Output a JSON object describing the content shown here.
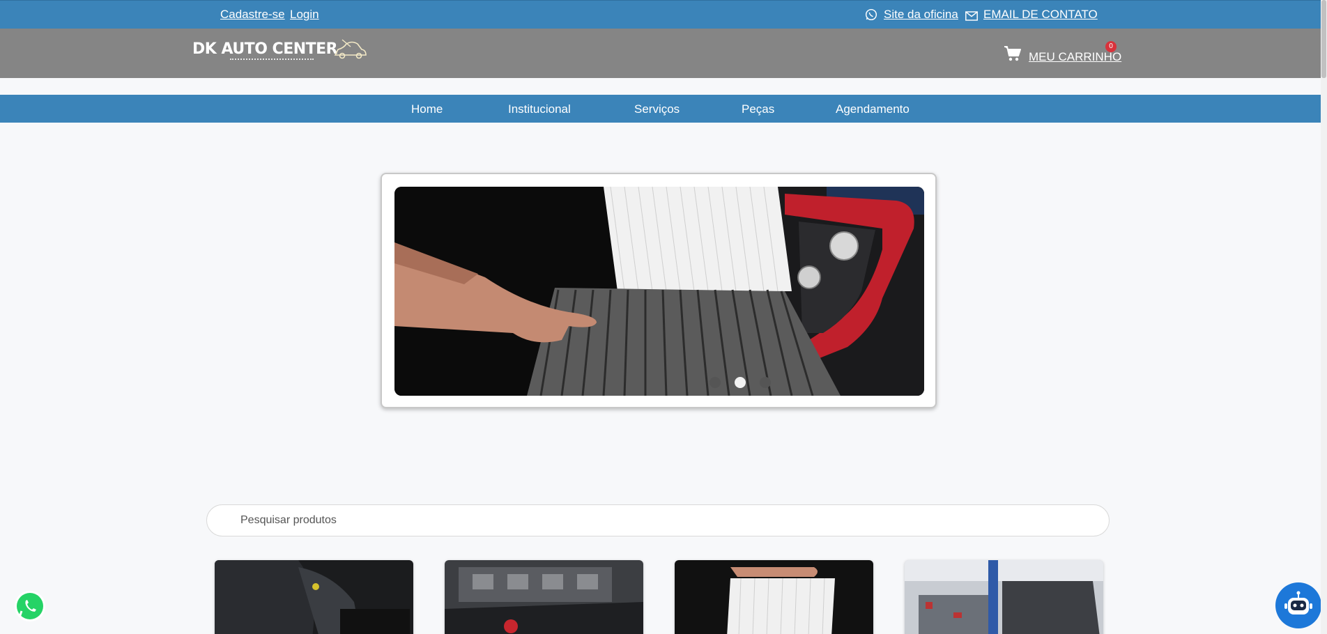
{
  "topbar": {
    "signup": "Cadastre-se",
    "login": "Login",
    "workshop_site": "Site da oficina",
    "contact_email": "EMAIL DE CONTATO",
    "workshop_icon": "whatsapp-icon",
    "email_icon": "mail-icon"
  },
  "header": {
    "logo_text": "DK AUTO CENTER",
    "cart_label": "MEU CARRINHO",
    "cart_count": "0"
  },
  "nav": {
    "items": [
      "Home",
      "Institucional",
      "Serviços",
      "Peças",
      "Agendamento"
    ]
  },
  "carousel": {
    "slides": 3,
    "active_slide": 2
  },
  "search": {
    "placeholder": "Pesquisar produtos"
  },
  "colors": {
    "primary": "#3b84b9",
    "header_gray": "#858585",
    "badge_red": "#d9323b",
    "chatbot_blue": "#1d78d9",
    "whatsapp_green": "#25d366"
  }
}
